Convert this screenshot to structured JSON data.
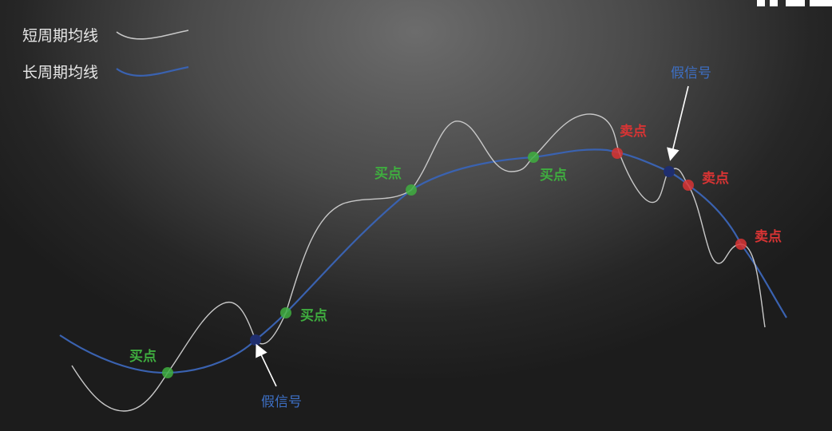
{
  "legend": {
    "short_line": "短周期均线",
    "long_line": "长周期均线"
  },
  "annotations": {
    "buy_1": "买点",
    "buy_2": "买点",
    "buy_3": "买点",
    "buy_4": "买点",
    "sell_1": "卖点",
    "sell_2": "卖点",
    "sell_3": "卖点",
    "false_1": "假信号",
    "false_2": "假信号"
  },
  "colors": {
    "short_line": "#c8c8c8",
    "long_line": "#3a62b0",
    "buy": "#3fae3f",
    "sell": "#d83434",
    "false_signal": "#1f2e6e",
    "false_label": "#3d6fc4"
  }
}
